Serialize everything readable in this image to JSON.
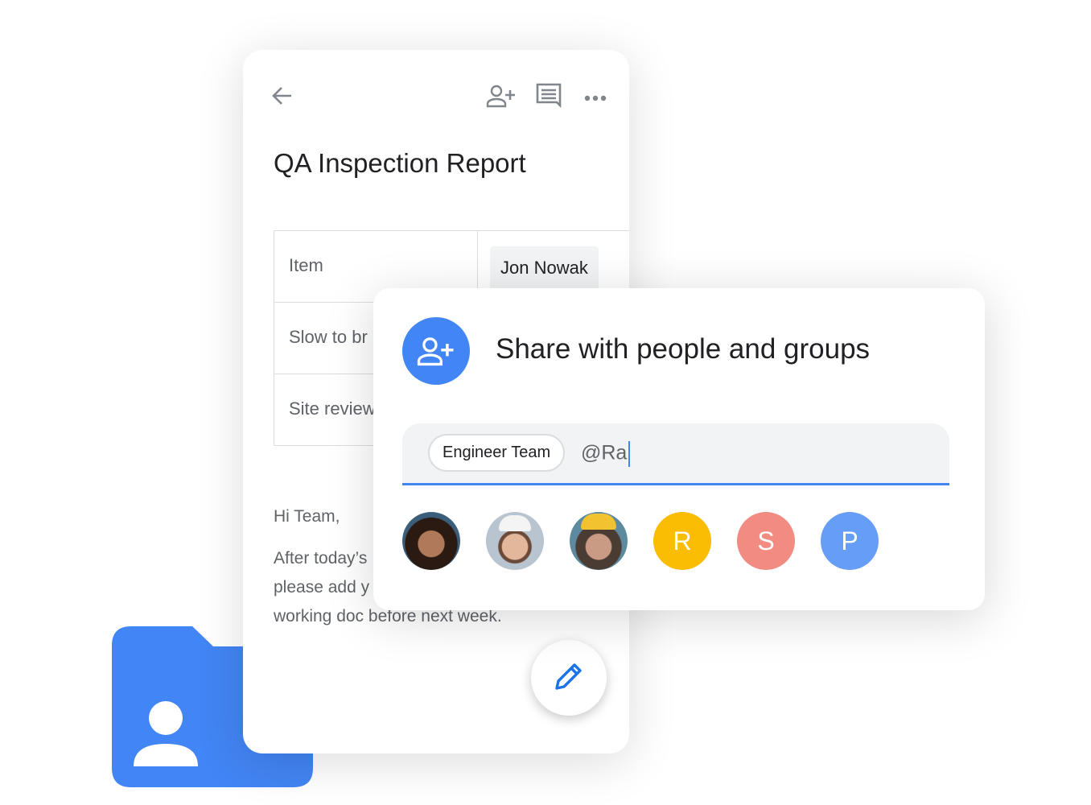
{
  "document": {
    "title": "QA Inspection Report",
    "table": {
      "rows": [
        {
          "item": "Item",
          "value": "Jon Nowak"
        },
        {
          "item": "Slow to br"
        },
        {
          "item": "Site review"
        }
      ]
    },
    "body": [
      "Hi Team,",
      "After today’s",
      "please add y",
      "working doc before next week."
    ],
    "icons": [
      "arrow-back-icon",
      "person-add-icon",
      "comment-icon",
      "more-horiz-icon",
      "edit-pencil-icon"
    ]
  },
  "share_dialog": {
    "title": "Share with people and groups",
    "chip": "Engineer Team",
    "input_value": "@Ra",
    "avatars": [
      {
        "type": "photo"
      },
      {
        "type": "photo"
      },
      {
        "type": "photo"
      },
      {
        "type": "initial",
        "letter": "R",
        "color": "#fbbc04"
      },
      {
        "type": "initial",
        "letter": "S",
        "color": "#f28b82"
      },
      {
        "type": "initial",
        "letter": "P",
        "color": "#669df6"
      }
    ]
  },
  "colors": {
    "accent": "#4285f4",
    "icon_gray": "#80868b"
  }
}
